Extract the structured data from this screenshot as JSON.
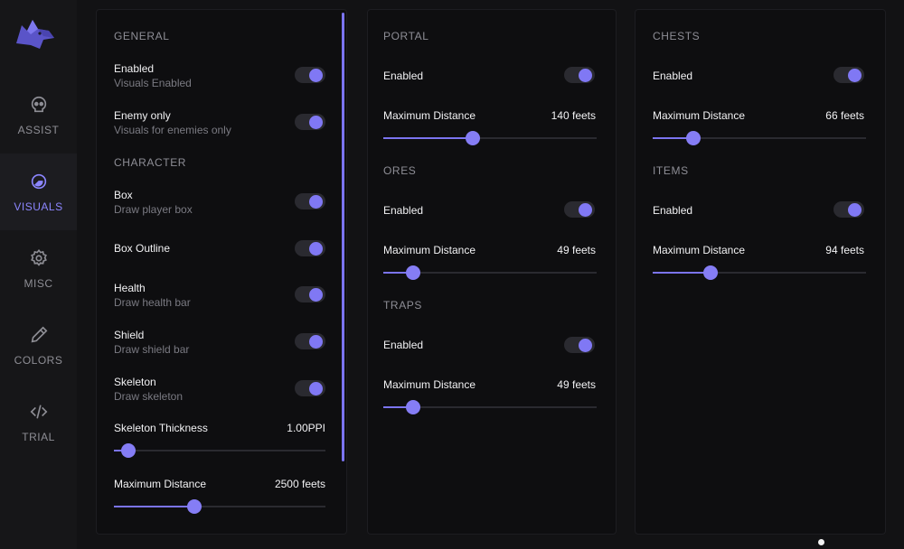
{
  "sidebar": {
    "items": [
      {
        "label": "ASSIST",
        "icon": "skull-icon",
        "active": false
      },
      {
        "label": "VISUALS",
        "icon": "eye-icon",
        "active": true
      },
      {
        "label": "MISC",
        "icon": "gear-icon",
        "active": false
      },
      {
        "label": "COLORS",
        "icon": "eyedropper-icon",
        "active": false
      },
      {
        "label": "TRIAL",
        "icon": "code-icon",
        "active": false
      }
    ]
  },
  "panel1": {
    "general_title": "GENERAL",
    "enabled": {
      "label": "Enabled",
      "sub": "Visuals Enabled",
      "on": true
    },
    "enemy_only": {
      "label": "Enemy only",
      "sub": "Visuals for enemies only",
      "on": true
    },
    "character_title": "CHARACTER",
    "box": {
      "label": "Box",
      "sub": "Draw player box",
      "on": true
    },
    "box_outline": {
      "label": "Box Outline",
      "on": true
    },
    "health": {
      "label": "Health",
      "sub": "Draw health bar",
      "on": true
    },
    "shield": {
      "label": "Shield",
      "sub": "Draw shield bar",
      "on": true
    },
    "skeleton": {
      "label": "Skeleton",
      "sub": "Draw skeleton",
      "on": true
    },
    "skeleton_thickness": {
      "label": "Skeleton Thickness",
      "value": "1.00PPI",
      "fraction": 0.07
    },
    "max_distance": {
      "label": "Maximum Distance",
      "value": "2500 feets",
      "fraction": 0.38
    }
  },
  "panel2": {
    "portal_title": "PORTAL",
    "portal_enabled": {
      "label": "Enabled",
      "on": true
    },
    "portal_distance": {
      "label": "Maximum Distance",
      "value": "140 feets",
      "fraction": 0.42
    },
    "ores_title": "ORES",
    "ores_enabled": {
      "label": "Enabled",
      "on": true
    },
    "ores_distance": {
      "label": "Maximum Distance",
      "value": "49 feets",
      "fraction": 0.14
    },
    "traps_title": "TRAPS",
    "traps_enabled": {
      "label": "Enabled",
      "on": true
    },
    "traps_distance": {
      "label": "Maximum Distance",
      "value": "49 feets",
      "fraction": 0.14
    }
  },
  "panel3": {
    "chests_title": "CHESTS",
    "chests_enabled": {
      "label": "Enabled",
      "on": true
    },
    "chests_distance": {
      "label": "Maximum Distance",
      "value": "66 feets",
      "fraction": 0.19
    },
    "items_title": "ITEMS",
    "items_enabled": {
      "label": "Enabled",
      "on": true
    },
    "items_distance": {
      "label": "Maximum Distance",
      "value": "94 feets",
      "fraction": 0.27
    }
  },
  "colors": {
    "accent": "#7b74f0",
    "background": "#121214",
    "panel": "#0e0e10"
  }
}
